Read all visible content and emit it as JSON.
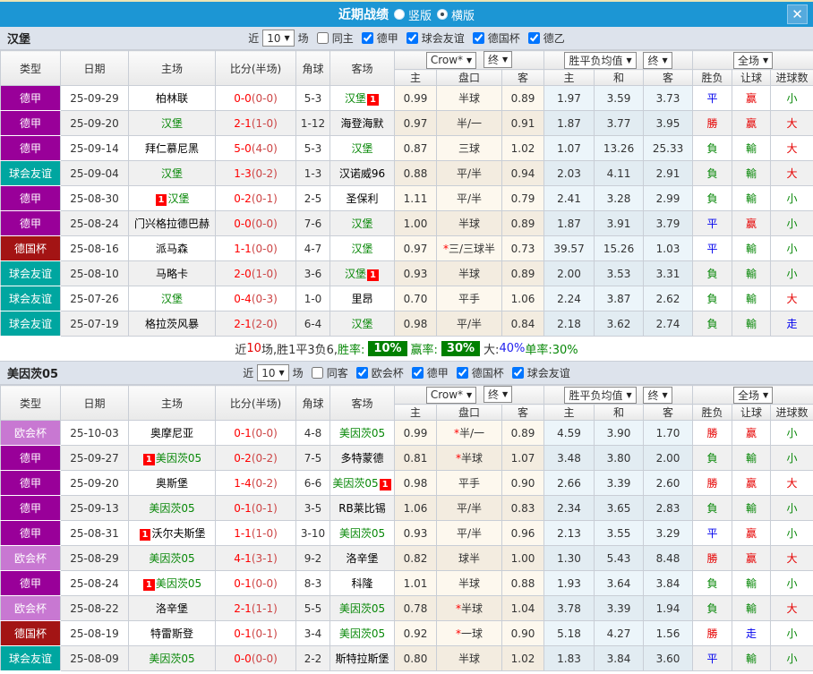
{
  "titlebar": {
    "title": "近期战绩",
    "radio_vertical": "竖版",
    "radio_horizontal": "横版",
    "close": "✕"
  },
  "table_header": {
    "type": "类型",
    "date": "日期",
    "home": "主场",
    "score": "比分(半场)",
    "corner": "角球",
    "away": "客场",
    "company_select": "Crow*",
    "final_select": "终",
    "mean_select": "胜平负均值",
    "mean_final_select": "终",
    "scope_select": "全场",
    "sub": [
      "主",
      "盘口",
      "客",
      "主",
      "和",
      "客",
      "胜负",
      "让球",
      "进球数"
    ]
  },
  "league_colors": {
    "德甲": "#990099",
    "球会友谊": "#00a6a0",
    "德国杯": "#a31414",
    "欧会杯": "#c878d2"
  },
  "result_colors": {
    "勝": "red",
    "負": "green",
    "平": "blue",
    "赢": "red",
    "輸": "green",
    "走": "blue",
    "大": "red",
    "小": "green"
  },
  "badge_text": "1",
  "sections": [
    {
      "team": "汉堡",
      "near_label": "近",
      "matches_count": "10",
      "matches_label": "场",
      "same_label": "同主",
      "same_checked": false,
      "league_filters": [
        "德甲",
        "球会友谊",
        "德国杯",
        "德乙"
      ],
      "rows": [
        {
          "type": "德甲",
          "date": "25-09-29",
          "home": {
            "name": "柏林联"
          },
          "score": "0-0",
          "half": "(0-0)",
          "corner": "5-3",
          "away": {
            "name": "汉堡",
            "green": true,
            "badge": "after"
          },
          "ah": {
            "h": "0.99",
            "line": "半球",
            "a": "0.89"
          },
          "mean": {
            "h": "1.97",
            "d": "3.59",
            "a": "3.73"
          },
          "res": [
            "平",
            "赢",
            "小"
          ]
        },
        {
          "type": "德甲",
          "date": "25-09-20",
          "home": {
            "name": "汉堡",
            "green": true
          },
          "score": "2-1",
          "half": "(1-0)",
          "corner": "1-12",
          "away": {
            "name": "海登海默"
          },
          "ah": {
            "h": "0.97",
            "line": "半/一",
            "a": "0.91"
          },
          "mean": {
            "h": "1.87",
            "d": "3.77",
            "a": "3.95"
          },
          "res": [
            "勝",
            "赢",
            "大"
          ]
        },
        {
          "type": "德甲",
          "date": "25-09-14",
          "home": {
            "name": "拜仁慕尼黑"
          },
          "score": "5-0",
          "half": "(4-0)",
          "corner": "5-3",
          "away": {
            "name": "汉堡",
            "green": true
          },
          "ah": {
            "h": "0.87",
            "line": "三球",
            "a": "1.02"
          },
          "mean": {
            "h": "1.07",
            "d": "13.26",
            "a": "25.33"
          },
          "res": [
            "負",
            "輸",
            "大"
          ]
        },
        {
          "type": "球会友谊",
          "date": "25-09-04",
          "home": {
            "name": "汉堡",
            "green": true
          },
          "score": "1-3",
          "half": "(0-2)",
          "corner": "1-3",
          "away": {
            "name": "汉诺威96"
          },
          "ah": {
            "h": "0.88",
            "line": "平/半",
            "a": "0.94"
          },
          "mean": {
            "h": "2.03",
            "d": "4.11",
            "a": "2.91"
          },
          "res": [
            "負",
            "輸",
            "大"
          ]
        },
        {
          "type": "德甲",
          "date": "25-08-30",
          "home": {
            "name": "汉堡",
            "green": true,
            "badge": "before"
          },
          "score": "0-2",
          "half": "(0-1)",
          "corner": "2-5",
          "away": {
            "name": "圣保利"
          },
          "ah": {
            "h": "1.11",
            "line": "平/半",
            "a": "0.79"
          },
          "mean": {
            "h": "2.41",
            "d": "3.28",
            "a": "2.99"
          },
          "res": [
            "負",
            "輸",
            "小"
          ]
        },
        {
          "type": "德甲",
          "date": "25-08-24",
          "home": {
            "name": "门兴格拉德巴赫"
          },
          "score": "0-0",
          "half": "(0-0)",
          "corner": "7-6",
          "away": {
            "name": "汉堡",
            "green": true
          },
          "ah": {
            "h": "1.00",
            "line": "半球",
            "a": "0.89"
          },
          "mean": {
            "h": "1.87",
            "d": "3.91",
            "a": "3.79"
          },
          "res": [
            "平",
            "赢",
            "小"
          ]
        },
        {
          "type": "德国杯",
          "date": "25-08-16",
          "home": {
            "name": "派马森"
          },
          "score": "1-1",
          "half": "(0-0)",
          "corner": "4-7",
          "away": {
            "name": "汉堡",
            "green": true
          },
          "ah": {
            "h": "0.97",
            "line": "*三/三球半",
            "a": "0.73"
          },
          "mean": {
            "h": "39.57",
            "d": "15.26",
            "a": "1.03"
          },
          "res": [
            "平",
            "輸",
            "小"
          ]
        },
        {
          "type": "球会友谊",
          "date": "25-08-10",
          "home": {
            "name": "马略卡"
          },
          "score": "2-0",
          "half": "(1-0)",
          "corner": "3-6",
          "away": {
            "name": "汉堡",
            "green": true,
            "badge": "after"
          },
          "ah": {
            "h": "0.93",
            "line": "半球",
            "a": "0.89"
          },
          "mean": {
            "h": "2.00",
            "d": "3.53",
            "a": "3.31"
          },
          "res": [
            "負",
            "輸",
            "小"
          ]
        },
        {
          "type": "球会友谊",
          "date": "25-07-26",
          "home": {
            "name": "汉堡",
            "green": true
          },
          "score": "0-4",
          "half": "(0-3)",
          "corner": "1-0",
          "away": {
            "name": "里昂"
          },
          "ah": {
            "h": "0.70",
            "line": "平手",
            "a": "1.06"
          },
          "mean": {
            "h": "2.24",
            "d": "3.87",
            "a": "2.62"
          },
          "res": [
            "負",
            "輸",
            "大"
          ]
        },
        {
          "type": "球会友谊",
          "date": "25-07-19",
          "home": {
            "name": "格拉茨风暴"
          },
          "score": "2-1",
          "half": "(2-0)",
          "corner": "6-4",
          "away": {
            "name": "汉堡",
            "green": true
          },
          "ah": {
            "h": "0.98",
            "line": "平/半",
            "a": "0.84"
          },
          "mean": {
            "h": "2.18",
            "d": "3.62",
            "a": "2.74"
          },
          "res": [
            "負",
            "輸",
            "走"
          ]
        }
      ],
      "summary": {
        "parts": [
          {
            "t": "近",
            "s": "plain"
          },
          {
            "t": "10",
            "s": "red"
          },
          {
            "t": "场,胜1平3负6, ",
            "s": "plain"
          },
          {
            "t": "胜率:",
            "s": "green"
          },
          {
            "t": "10%",
            "s": "badge"
          },
          {
            "t": "赢率:",
            "s": "green"
          },
          {
            "t": "30%",
            "s": "badge"
          },
          {
            "t": "大:",
            "s": "plain"
          },
          {
            "t": "40%",
            "s": "blue"
          },
          {
            "t": " 单率:30%",
            "s": "green"
          }
        ]
      }
    },
    {
      "team": "美因茨05",
      "near_label": "近",
      "matches_count": "10",
      "matches_label": "场",
      "same_label": "同客",
      "same_checked": false,
      "league_filters": [
        "欧会杯",
        "德甲",
        "德国杯",
        "球会友谊"
      ],
      "rows": [
        {
          "type": "欧会杯",
          "date": "25-10-03",
          "home": {
            "name": "奥摩尼亚"
          },
          "score": "0-1",
          "half": "(0-0)",
          "corner": "4-8",
          "away": {
            "name": "美因茨05",
            "green": true
          },
          "ah": {
            "h": "0.99",
            "line": "*半/一",
            "a": "0.89"
          },
          "mean": {
            "h": "4.59",
            "d": "3.90",
            "a": "1.70"
          },
          "res": [
            "勝",
            "赢",
            "小"
          ]
        },
        {
          "type": "德甲",
          "date": "25-09-27",
          "home": {
            "name": "美因茨05",
            "green": true,
            "badge": "before"
          },
          "score": "0-2",
          "half": "(0-2)",
          "corner": "7-5",
          "away": {
            "name": "多特蒙德"
          },
          "ah": {
            "h": "0.81",
            "line": "*半球",
            "a": "1.07"
          },
          "mean": {
            "h": "3.48",
            "d": "3.80",
            "a": "2.00"
          },
          "res": [
            "負",
            "輸",
            "小"
          ]
        },
        {
          "type": "德甲",
          "date": "25-09-20",
          "home": {
            "name": "奥斯堡"
          },
          "score": "1-4",
          "half": "(0-2)",
          "corner": "6-6",
          "away": {
            "name": "美因茨05",
            "green": true,
            "badge": "after"
          },
          "ah": {
            "h": "0.98",
            "line": "平手",
            "a": "0.90"
          },
          "mean": {
            "h": "2.66",
            "d": "3.39",
            "a": "2.60"
          },
          "res": [
            "勝",
            "赢",
            "大"
          ]
        },
        {
          "type": "德甲",
          "date": "25-09-13",
          "home": {
            "name": "美因茨05",
            "green": true
          },
          "score": "0-1",
          "half": "(0-1)",
          "corner": "3-5",
          "away": {
            "name": "RB莱比锡"
          },
          "ah": {
            "h": "1.06",
            "line": "平/半",
            "a": "0.83"
          },
          "mean": {
            "h": "2.34",
            "d": "3.65",
            "a": "2.83"
          },
          "res": [
            "負",
            "輸",
            "小"
          ]
        },
        {
          "type": "德甲",
          "date": "25-08-31",
          "home": {
            "name": "沃尔夫斯堡",
            "badge": "before"
          },
          "score": "1-1",
          "half": "(1-0)",
          "corner": "3-10",
          "away": {
            "name": "美因茨05",
            "green": true
          },
          "ah": {
            "h": "0.93",
            "line": "平/半",
            "a": "0.96"
          },
          "mean": {
            "h": "2.13",
            "d": "3.55",
            "a": "3.29"
          },
          "res": [
            "平",
            "赢",
            "小"
          ]
        },
        {
          "type": "欧会杯",
          "date": "25-08-29",
          "home": {
            "name": "美因茨05",
            "green": true
          },
          "score": "4-1",
          "half": "(3-1)",
          "corner": "9-2",
          "away": {
            "name": "洛辛堡"
          },
          "ah": {
            "h": "0.82",
            "line": "球半",
            "a": "1.00"
          },
          "mean": {
            "h": "1.30",
            "d": "5.43",
            "a": "8.48"
          },
          "res": [
            "勝",
            "赢",
            "大"
          ]
        },
        {
          "type": "德甲",
          "date": "25-08-24",
          "home": {
            "name": "美因茨05",
            "green": true,
            "badge": "before"
          },
          "score": "0-1",
          "half": "(0-0)",
          "corner": "8-3",
          "away": {
            "name": "科隆"
          },
          "ah": {
            "h": "1.01",
            "line": "半球",
            "a": "0.88"
          },
          "mean": {
            "h": "1.93",
            "d": "3.64",
            "a": "3.84"
          },
          "res": [
            "負",
            "輸",
            "小"
          ]
        },
        {
          "type": "欧会杯",
          "date": "25-08-22",
          "home": {
            "name": "洛辛堡"
          },
          "score": "2-1",
          "half": "(1-1)",
          "corner": "5-5",
          "away": {
            "name": "美因茨05",
            "green": true
          },
          "ah": {
            "h": "0.78",
            "line": "*半球",
            "a": "1.04"
          },
          "mean": {
            "h": "3.78",
            "d": "3.39",
            "a": "1.94"
          },
          "res": [
            "負",
            "輸",
            "大"
          ]
        },
        {
          "type": "德国杯",
          "date": "25-08-19",
          "home": {
            "name": "特雷斯登"
          },
          "score": "0-1",
          "half": "(0-1)",
          "corner": "3-4",
          "away": {
            "name": "美因茨05",
            "green": true
          },
          "ah": {
            "h": "0.92",
            "line": "*一球",
            "a": "0.90"
          },
          "mean": {
            "h": "5.18",
            "d": "4.27",
            "a": "1.56"
          },
          "res": [
            "勝",
            "走",
            "小"
          ]
        },
        {
          "type": "球会友谊",
          "date": "25-08-09",
          "home": {
            "name": "美因茨05",
            "green": true
          },
          "score": "0-0",
          "half": "(0-0)",
          "corner": "2-2",
          "away": {
            "name": "斯特拉斯堡"
          },
          "ah": {
            "h": "0.80",
            "line": "半球",
            "a": "1.02"
          },
          "mean": {
            "h": "1.83",
            "d": "3.84",
            "a": "3.60"
          },
          "res": [
            "平",
            "輸",
            "小"
          ]
        }
      ]
    }
  ]
}
